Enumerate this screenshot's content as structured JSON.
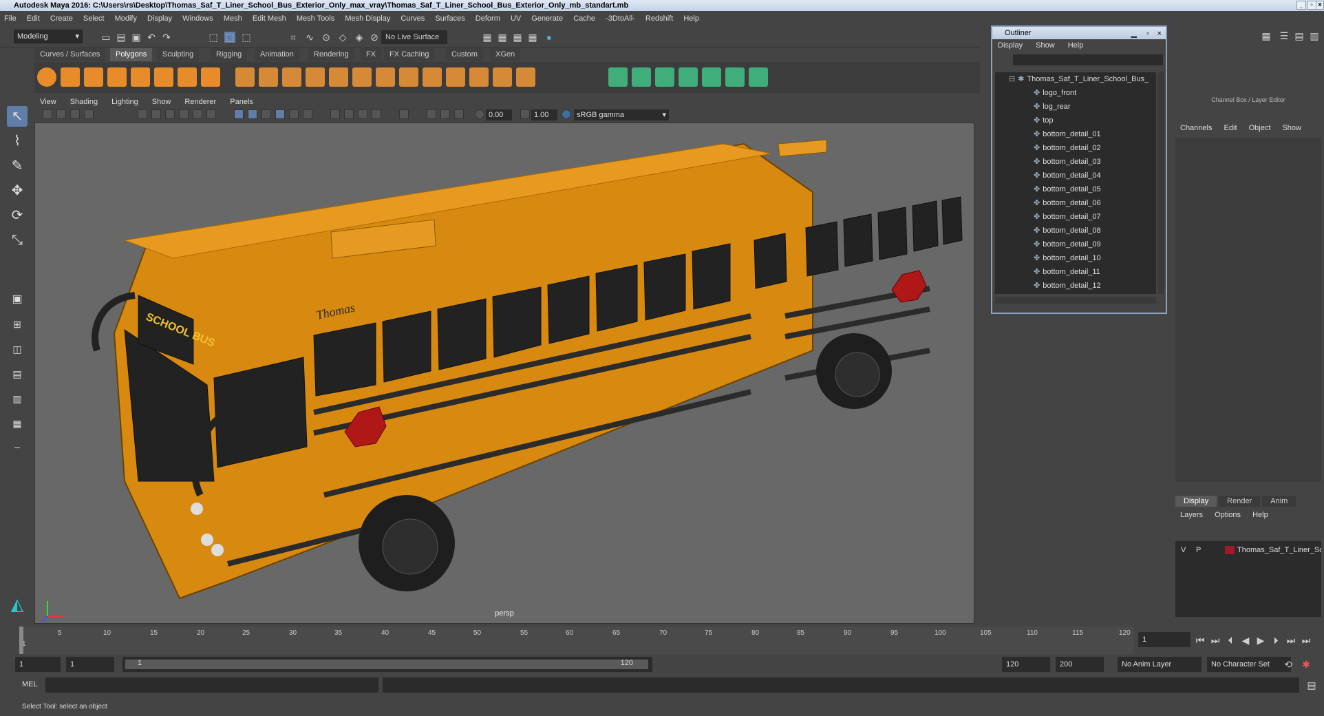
{
  "window": {
    "title": "Autodesk Maya 2016: C:\\Users\\rs\\Desktop\\Thomas_Saf_T_Liner_School_Bus_Exterior_Only_max_vray\\Thomas_Saf_T_Liner_School_Bus_Exterior_Only_mb_standart.mb"
  },
  "menu": [
    "File",
    "Edit",
    "Create",
    "Select",
    "Modify",
    "Display",
    "Windows",
    "Mesh",
    "Edit Mesh",
    "Mesh Tools",
    "Mesh Display",
    "Curves",
    "Surfaces",
    "Deform",
    "UV",
    "Generate",
    "Cache",
    "-3DtoAll-",
    "Redshift",
    "Help"
  ],
  "status": {
    "mode": "Modeling",
    "live_surface": "No Live Surface"
  },
  "shelf_tabs": [
    "Curves / Surfaces",
    "Polygons",
    "Sculpting",
    "Rigging",
    "Animation",
    "Rendering",
    "FX",
    "FX Caching",
    "Custom",
    "XGen"
  ],
  "shelf_active": "Polygons",
  "panel_menu": [
    "View",
    "Shading",
    "Lighting",
    "Show",
    "Renderer",
    "Panels"
  ],
  "panel_toolbar": {
    "exposure": "0.00",
    "gamma": "1.00",
    "color_space": "sRGB gamma"
  },
  "viewport": {
    "camera": "persp",
    "bus_sign": "SCHOOL BUS",
    "bus_brand": "Thomas"
  },
  "outliner": {
    "title": "Outliner",
    "menu": [
      "Display",
      "Show",
      "Help"
    ],
    "root": "Thomas_Saf_T_Liner_School_Bus_",
    "items": [
      "logo_front",
      "log_rear",
      "top",
      "bottom_detail_01",
      "bottom_detail_02",
      "bottom_detail_03",
      "bottom_detail_04",
      "bottom_detail_05",
      "bottom_detail_06",
      "bottom_detail_07",
      "bottom_detail_08",
      "bottom_detail_09",
      "bottom_detail_10",
      "bottom_detail_11",
      "bottom_detail_12"
    ]
  },
  "channel_box": {
    "title": "Channel Box / Layer Editor",
    "menu": [
      "Channels",
      "Edit",
      "Object",
      "Show"
    ],
    "tabs": [
      "Display",
      "Render",
      "Anim"
    ],
    "layer_menu": [
      "Layers",
      "Options",
      "Help"
    ],
    "layer": {
      "v": "V",
      "p": "P",
      "name": "Thomas_Saf_T_Liner_Sc"
    }
  },
  "timeline": {
    "ticks": [
      "5",
      "10",
      "15",
      "20",
      "25",
      "30",
      "35",
      "40",
      "45",
      "50",
      "55",
      "60",
      "65",
      "70",
      "75",
      "80",
      "85",
      "90",
      "95",
      "100",
      "105",
      "110",
      "115",
      "120"
    ],
    "start": "1",
    "current": "1"
  },
  "range": {
    "start": "1",
    "inner_start": "1",
    "slider_start": "1",
    "slider_end": "120",
    "end": "120",
    "max": "200",
    "anim_layer": "No Anim Layer",
    "char_set": "No Character Set"
  },
  "command": {
    "label": "MEL"
  },
  "help_line": "Select Tool: select an object"
}
